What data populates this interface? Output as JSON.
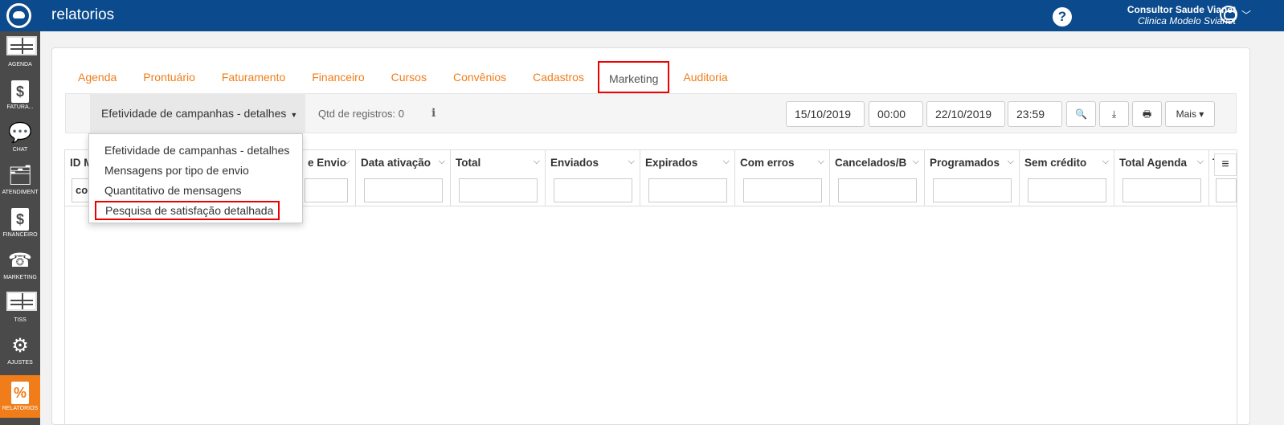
{
  "header": {
    "title": "relatorios",
    "help_icon": "?",
    "user_name": "Consultor Saude Vianet",
    "clinic_name": "Clinica Modelo Svianet",
    "chevron": "﹀"
  },
  "sidebar": {
    "items": [
      {
        "label": "AGENDA",
        "icon": "book-icon"
      },
      {
        "label": "FATURA...",
        "icon": "dollar-doc-icon",
        "glyph": "$"
      },
      {
        "label": "CHAT",
        "icon": "chat-icon",
        "glyph": "💬"
      },
      {
        "label": "ATENDIMENT",
        "icon": "folder-check-icon",
        "glyph": "🗂"
      },
      {
        "label": "FINANCEIRO",
        "icon": "dollar-doc-icon",
        "glyph": "$"
      },
      {
        "label": "MARKETING",
        "icon": "phone-icon",
        "glyph": "☎"
      },
      {
        "label": "TISS",
        "icon": "book-icon"
      },
      {
        "label": "AJUSTES",
        "icon": "gears-icon",
        "glyph": "⚙"
      },
      {
        "label": "RELATORIOS",
        "icon": "percent-doc-icon",
        "glyph": "%"
      }
    ]
  },
  "tabs": [
    {
      "label": "Agenda"
    },
    {
      "label": "Prontuário"
    },
    {
      "label": "Faturamento"
    },
    {
      "label": "Financeiro"
    },
    {
      "label": "Cursos"
    },
    {
      "label": "Convênios"
    },
    {
      "label": "Cadastros"
    },
    {
      "label": "Marketing"
    },
    {
      "label": "Auditoria"
    }
  ],
  "toolbar": {
    "report_selected": "Efetividade de campanhas - detalhes",
    "caret": "▼",
    "count_label": "Qtd de registros: 0",
    "info_icon": "i",
    "date_start": "15/10/2019",
    "time_start": "00:00",
    "date_end": "22/10/2019",
    "time_end": "23:59",
    "search_icon": "🔍",
    "download_icon": "⤓",
    "print_icon": "🖶",
    "more_label": "Mais ▾"
  },
  "dropdown": {
    "items": [
      "Efetividade de campanhas - detalhes",
      "Mensagens por tipo de envio",
      "Quantitativo de mensagens",
      "Pesquisa de satisfação detalhada"
    ]
  },
  "grid": {
    "columns": [
      {
        "title": "ID M",
        "sort": "",
        "filter": "co"
      },
      {
        "title": "e Envio",
        "sort": "⌵",
        "filter": ""
      },
      {
        "title": "Data ativação",
        "sort": "⌵",
        "filter": ""
      },
      {
        "title": "Total",
        "sort": "⌵",
        "filter": ""
      },
      {
        "title": "Enviados",
        "sort": "⌵",
        "filter": ""
      },
      {
        "title": "Expirados",
        "sort": "⌵",
        "filter": ""
      },
      {
        "title": "Com erros",
        "sort": "⌵",
        "filter": ""
      },
      {
        "title": "Cancelados/B",
        "sort": "⌵",
        "filter": ""
      },
      {
        "title": "Programados",
        "sort": "⌵",
        "filter": ""
      },
      {
        "title": "Sem crédito",
        "sort": "⌵",
        "filter": ""
      },
      {
        "title": "Total Agenda",
        "sort": "⌵",
        "filter": ""
      },
      {
        "title": "T",
        "sort": "",
        "filter": ""
      }
    ],
    "menu_icon": "≡"
  }
}
